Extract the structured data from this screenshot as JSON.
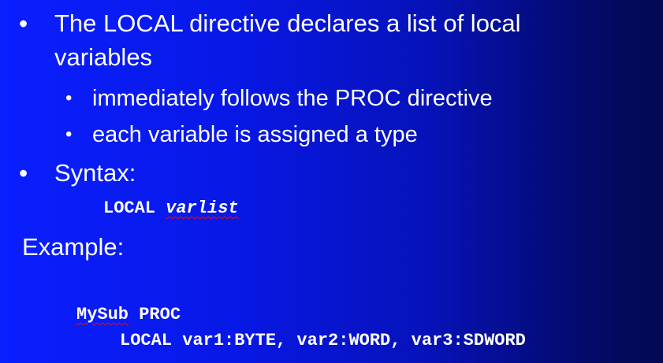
{
  "slide": {
    "bullet_char": "•",
    "item1": {
      "line1": "The LOCAL directive declares a list of local",
      "line2": "variables"
    },
    "subitems": [
      "immediately follows the PROC directive",
      "each variable is assigned a type"
    ],
    "item2": "Syntax:",
    "syntax": {
      "keyword": "LOCAL",
      "arg": "varlist"
    },
    "example_label": "Example:",
    "code": {
      "proc_name": "MySub",
      "proc_keyword": "PROC",
      "local_line": "LOCAL var1:BYTE, var2:WORD, var3:SDWORD"
    }
  }
}
